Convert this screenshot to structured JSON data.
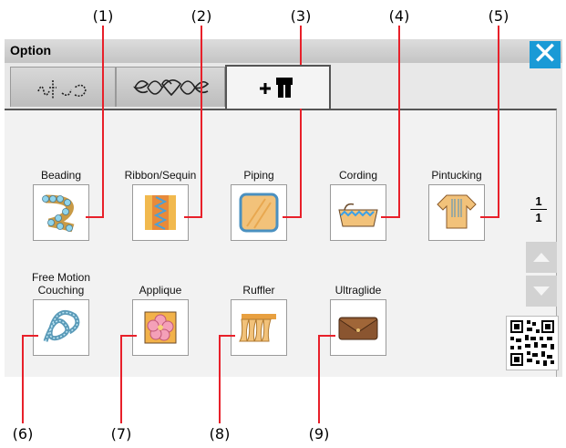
{
  "window": {
    "title": "Option"
  },
  "tabs": [
    {
      "name": "stitch-sample-tab",
      "glyph": "sewing-letters-icon"
    },
    {
      "name": "decorative-stitch-tab",
      "glyph": "heart-flourish-icon"
    },
    {
      "name": "option-feet-tab",
      "glyph": "presser-foot-plus-icon"
    }
  ],
  "callouts_top": [
    "(1)",
    "(2)",
    "(3)",
    "(4)",
    "(5)"
  ],
  "callouts_bottom": [
    "(6)",
    "(7)",
    "(8)",
    "(9)"
  ],
  "items": [
    {
      "label": "Beading",
      "icon": "beading-icon"
    },
    {
      "label": "Ribbon/Sequin",
      "icon": "ribbon-sequin-icon"
    },
    {
      "label": "Piping",
      "icon": "piping-icon"
    },
    {
      "label": "Cording",
      "icon": "cording-icon"
    },
    {
      "label": "Pintucking",
      "icon": "pintucking-icon"
    },
    {
      "label_line1": "Free Motion",
      "label": "Couching",
      "icon": "couching-icon"
    },
    {
      "label": "Applique",
      "icon": "applique-icon"
    },
    {
      "label": "Ruffler",
      "icon": "ruffler-icon"
    },
    {
      "label": "Ultraglide",
      "icon": "ultraglide-icon"
    }
  ],
  "pager": {
    "current": "1",
    "total": "1"
  },
  "colors": {
    "close_button": "#1a9ad6",
    "callout_line": "#e8202a"
  }
}
